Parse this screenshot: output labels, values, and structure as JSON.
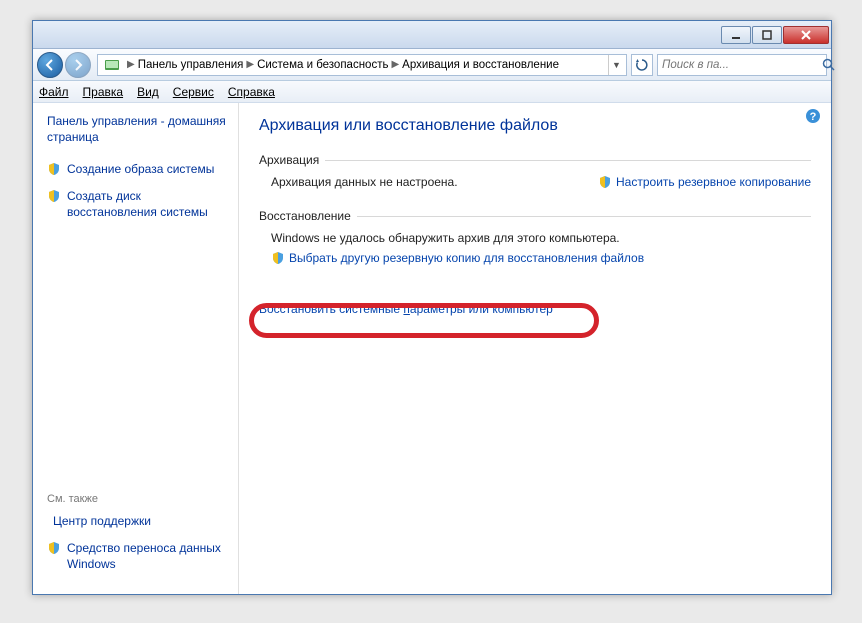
{
  "titlebar": {},
  "breadcrumb": {
    "seg1": "Панель управления",
    "seg2": "Система и безопасность",
    "seg3": "Архивация и восстановление"
  },
  "search": {
    "placeholder": "Поиск в па..."
  },
  "menu": {
    "file": "Файл",
    "edit": "Правка",
    "view": "Вид",
    "tools": "Сервис",
    "help": "Справка"
  },
  "sidebar": {
    "home": "Панель управления - домашняя страница",
    "links": [
      "Создание образа системы",
      "Создать диск восстановления системы"
    ],
    "see_also_label": "См. также",
    "see_also": [
      "Центр поддержки",
      "Средство переноса данных Windows"
    ]
  },
  "content": {
    "title": "Архивация или восстановление файлов",
    "sect1": {
      "header": "Архивация",
      "text": "Архивация данных не настроена.",
      "configure": "Настроить резервное копирование"
    },
    "sect2": {
      "header": "Восстановление",
      "text": "Windows не удалось обнаружить архив для этого компьютера.",
      "link1": "Выбрать другую резервную копию для восстановления файлов",
      "link2_a": "Восстановить системные ",
      "link2_u": "п",
      "link2_b": "араметры или компьютер"
    }
  }
}
